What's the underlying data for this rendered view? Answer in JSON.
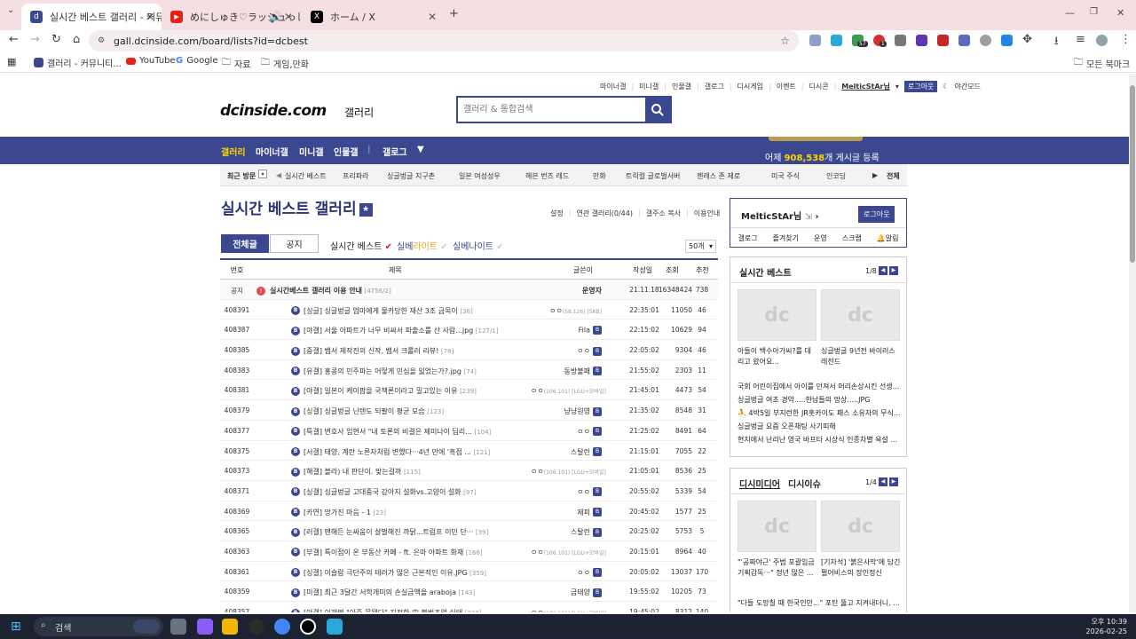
{
  "browser": {
    "tabs": [
      {
        "title": "실시간 베스트 갤러리 - 커뮤니",
        "active": true,
        "favicon": "dc",
        "color": "#3b4890"
      },
      {
        "title": "めにしゅき♡ラッシュっし",
        "active": false,
        "favicon": "▶",
        "color": "#e62117"
      },
      {
        "title": "ホーム / X",
        "active": false,
        "favicon": "X",
        "color": "#000000"
      }
    ],
    "new_tab": "+",
    "url": "gall.dcinside.com/board/lists?id=dcbest",
    "extension_badges": [
      "57",
      "1"
    ],
    "bookmarks": [
      {
        "label": "갤러리 - 커뮤니티...",
        "icon": "dc-icon"
      },
      {
        "label": "YouTube",
        "icon": "youtube-icon"
      },
      {
        "label": "Google",
        "icon": "google-icon"
      },
      {
        "label": "자료",
        "icon": "folder-icon"
      },
      {
        "label": "게임,만화",
        "icon": "folder-icon"
      }
    ],
    "all_bookmarks": "모든 북마크"
  },
  "site": {
    "toplinks": [
      "마이너갤",
      "미니갤",
      "인물갤",
      "갤로그",
      "디시게임",
      "이벤트",
      "디시콘"
    ],
    "user": "MelticStAr님",
    "logout": "로그아웃",
    "dark_mode": "야간모드",
    "logo": "dcinside.com",
    "logo_sub": "갤러리",
    "search_placeholder": "갤러리 & 통합검색",
    "gnb": [
      "갤러리",
      "마이너갤",
      "미니갤",
      "인물갤",
      "갤로그"
    ],
    "yesterday_prefix": "어제",
    "yesterday_count": "908,538",
    "yesterday_suffix": "개 게시글 등록",
    "recent_label": "최근 방문",
    "recent": [
      "실시간 베스트",
      "프리파라",
      "싱글벙글 지구촌",
      "일본 여성성우",
      "헤븐 번즈 레드",
      "만화",
      "트릭컬 글로벌서버",
      "젠레스 존 제로",
      "미국 주식",
      "인코딩"
    ],
    "recent_all": "전체"
  },
  "gallery": {
    "title": "실시간 베스트 갤러리",
    "tools": [
      "설정",
      "연관 갤러리(0/44)",
      "갤주소 복사",
      "이용안내"
    ],
    "tab_all": "전체글",
    "tab_notice": "공지",
    "sub1": "실시간 베스트",
    "sub2_a": "실베",
    "sub2_b": "라이트",
    "sub3": "실베나이트",
    "per_page": "50개",
    "headers": {
      "no": "번호",
      "title": "제목",
      "writer": "글쓴이",
      "date": "작성일",
      "views": "조회",
      "rec": "추천"
    },
    "notice": {
      "no": "공지",
      "title": "실시간베스트 갤러리 이용 안내",
      "cmt": "[4756/2]",
      "writer": "운영자",
      "date": "21.11.18",
      "views": "16348424",
      "rec": "738"
    },
    "rows": [
      {
        "no": "408391",
        "title": "[싱글] 싱글벙글 엄마에게 물카당한 재산 3조 금목이",
        "cmt": "[36]",
        "writer": "ㅇㅇ",
        "ip": "(58.126) [5KB]",
        "date": "22:35:01",
        "views": "11050",
        "rec": "46"
      },
      {
        "no": "408387",
        "title": "[야갤] 서울 아파트가 너무 비싸서 파출소를 산 사람...jpg",
        "cmt": "[127/1]",
        "writer": "Fila",
        "ip": "",
        "date": "22:15:02",
        "views": "10629",
        "rec": "94"
      },
      {
        "no": "408385",
        "title": "[중갤] 뱀서 제작진의 신작, 뱀서 크롤러 리뷰!",
        "cmt": "[78]",
        "writer": "ㅇㅇ",
        "ip": "",
        "date": "22:05:02",
        "views": "9304",
        "rec": "46"
      },
      {
        "no": "408383",
        "title": "[유갤] 홍콩의 민주파는 어떻게 민심을 잃었는가?.jpg",
        "cmt": "[74]",
        "writer": "동방불패",
        "ip": "",
        "date": "21:55:02",
        "views": "2303",
        "rec": "11"
      },
      {
        "no": "408381",
        "title": "[야갤] 일본이 케이팝을 국책론이라고 밀고있는 이유",
        "cmt": "[239]",
        "writer": "ㅇㅇ",
        "ip": "(106.101) [LGU+모바일]",
        "date": "21:45:01",
        "views": "4473",
        "rec": "54"
      },
      {
        "no": "408379",
        "title": "[싱갤] 싱글벙글 닌텐도 되팔이 평균 모습",
        "cmt": "[123]",
        "writer": "냥냥원영",
        "ip": "",
        "date": "21:35:02",
        "views": "8548",
        "rec": "31"
      },
      {
        "no": "408377",
        "title": "[특갤] 변호사 임현서 \"내 토론의 비결은 제미나이 딥리...",
        "cmt": "[104]",
        "writer": "ㅇㅇ",
        "ip": "",
        "date": "21:25:02",
        "views": "8491",
        "rec": "64"
      },
      {
        "no": "408375",
        "title": "[서갤] 태양, 계란 노른자처럼 변했다···4년 만에 '흑점 ...",
        "cmt": "[121]",
        "writer": "스탈린",
        "ip": "",
        "date": "21:15:01",
        "views": "7055",
        "rec": "22"
      },
      {
        "no": "408373",
        "title": "[해갤] 블라) 내 판단이. 맞는걸까",
        "cmt": "[115]",
        "writer": "ㅇㅇ",
        "ip": "(106.101) [LGU+모바일]",
        "date": "21:05:01",
        "views": "8536",
        "rec": "25"
      },
      {
        "no": "408371",
        "title": "[싱갤] 싱글벙글 고대중국 강아지 설화vs.고양이 설화",
        "cmt": "[97]",
        "writer": "ㅇㅇ",
        "ip": "",
        "date": "20:55:02",
        "views": "5339",
        "rec": "54"
      },
      {
        "no": "408369",
        "title": "[카연] 망가진 마음 - 1",
        "cmt": "[23]",
        "writer": "제피",
        "ip": "",
        "date": "20:45:02",
        "views": "1577",
        "rec": "25"
      },
      {
        "no": "408365",
        "title": "[러갤] 맨해든 눈싸움이 살벌해진 까닭...트럼프 이민 단···",
        "cmt": "[39]",
        "writer": "스탈린",
        "ip": "",
        "date": "20:25:02",
        "views": "5753",
        "rec": "5"
      },
      {
        "no": "408363",
        "title": "[부갤] 특이점이 온 부동산 카페 - ft. 은마 아파트 화재",
        "cmt": "[166]",
        "writer": "ㅇㅇ",
        "ip": "(106.101) [LGU+모바일]",
        "date": "20:15:01",
        "views": "8964",
        "rec": "40"
      },
      {
        "no": "408361",
        "title": "[싱갤] 이슬람 극단주의 테러가 많은 근본적인 이유.JPG",
        "cmt": "[359]",
        "writer": "ㅇㅇ",
        "ip": "",
        "date": "20:05:02",
        "views": "13037",
        "rec": "170"
      },
      {
        "no": "408359",
        "title": "[미갤] 최근 3달간 서학개미의 손실금액을 araboja",
        "cmt": "[143]",
        "writer": "금태양",
        "ip": "",
        "date": "19:55:02",
        "views": "10205",
        "rec": "73"
      },
      {
        "no": "408357",
        "title": "[야갤] 이재명 \"아주 못됐다\" 지적한 中 불법조업 실태",
        "cmt": "[228]",
        "writer": "ㅇㅇ",
        "ip": "(106.101) [LGU+모바일]",
        "date": "19:45:02",
        "views": "8312",
        "rec": "140"
      }
    ]
  },
  "sidebar": {
    "user": "MelticStAr님",
    "logout": "로그아웃",
    "menu": [
      "갤로그",
      "즐겨찾기",
      "운영",
      "스크랩",
      "알림"
    ],
    "best_title": "실시간 베스트",
    "best_page": "1/8",
    "best_thumbs": [
      "아들이 백수아가씨?를 데리고 왔어요...",
      "싱글벙글 9년전 바이러스 레전드"
    ],
    "best_list": [
      "국회 어린이집에서 아이를 던져서 머리손상시킨 선생...",
      "싱글벙글 여초 경악.....한남들의 망상.....JPG",
      "4박5일 부지런한 JR홋카이도 패스 소유자의 무식...",
      "싱글벙글 요즘 오픈채팅 사기피해",
      "현지에서 난리난 영국 바프타 시상식 인종차별 욕설 ..."
    ],
    "media_title": "디시미디어",
    "issue_title": "디시이슈",
    "media_page": "1/4",
    "media_thumbs": [
      "\"'공짜야근' 주범 포괄임금 기획감독···\" 정년 많은 ...",
      "[기자석] '붉은사막'에 담긴 펄어비스의 장인정신"
    ],
    "media_list": [
      "\"다들 도망칠 때 한국인만...\" 포탄 뚫고 지켜내더니, ..."
    ]
  },
  "taskbar": {
    "search": "검색",
    "time": "오후 10:39",
    "date": "2026-02-25"
  }
}
